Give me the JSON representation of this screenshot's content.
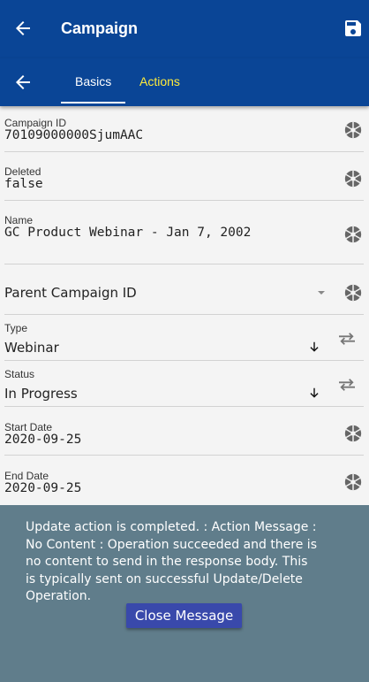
{
  "appbar": {
    "title": "Campaign",
    "back_icon": "arrow-left-icon",
    "save_icon": "floppy-disk-icon"
  },
  "tabs": {
    "back_icon": "arrow-left-icon",
    "items": [
      {
        "label": "Basics",
        "active": true
      },
      {
        "label": "Actions",
        "active": false
      }
    ],
    "active_color": "#ffffff",
    "inactive_color": "#ffeb3b"
  },
  "fields": {
    "campaign_id": {
      "label": "Campaign ID",
      "value": "70109000000SjumAAC"
    },
    "deleted": {
      "label": "Deleted",
      "value": "false"
    },
    "name": {
      "label": "Name",
      "value": "GC Product Webinar - Jan 7, 2002"
    },
    "parent_campaign": {
      "placeholder": "Parent Campaign ID"
    },
    "type": {
      "label": "Type",
      "value": "Webinar"
    },
    "status": {
      "label": "Status",
      "value": "In Progress"
    },
    "start_date": {
      "label": "Start Date",
      "value": "2020-09-25"
    },
    "end_date": {
      "label": "End Date",
      "value": "2020-09-25"
    }
  },
  "message": {
    "lines": [
      "Update action is completed.  : Action Message :",
      "No Content : Operation succeeded and there is",
      "no content to send in the response body. This",
      "is typically sent on successful Update/Delete",
      "Operation."
    ],
    "close_label": "Close Message"
  },
  "colors": {
    "primary": "#0a4596",
    "overlay": "#607d8b",
    "button": "#3949ab",
    "accent": "#ffeb3b"
  }
}
